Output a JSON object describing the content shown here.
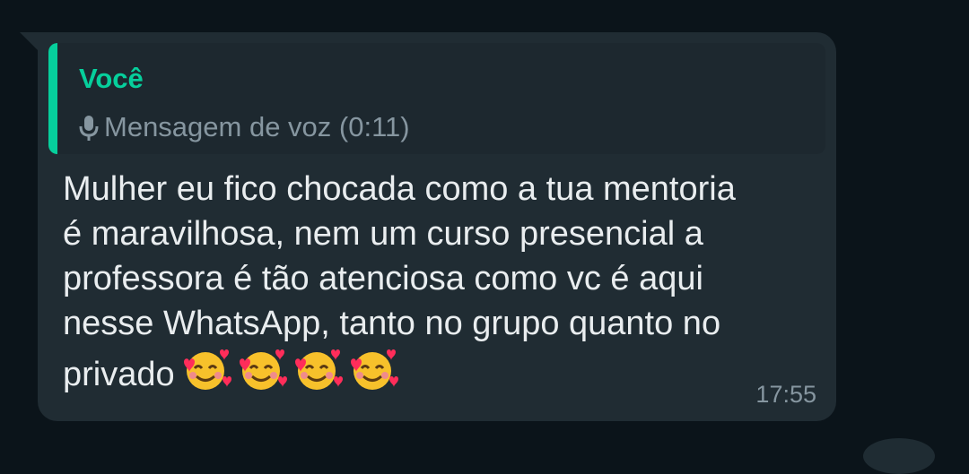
{
  "message": {
    "quoted": {
      "author": "Você",
      "text": "Mensagem de voz (0:11)",
      "icon": "mic-icon"
    },
    "text": "Mulher eu fico chocada como a tua mentoria\né maravilhosa, nem um curso presencial a\nprofessora é tão atenciosa como vc é aqui\nnesse WhatsApp, tanto no grupo quanto no\nprivado",
    "emoji": "smiling-face-with-hearts",
    "emoji_count": 4,
    "time": "17:55"
  },
  "colors": {
    "background": "#0b141a",
    "bubble": "#202c33",
    "quote_accent": "#06cf9c",
    "text": "#e9edef",
    "muted": "#8696a0"
  }
}
